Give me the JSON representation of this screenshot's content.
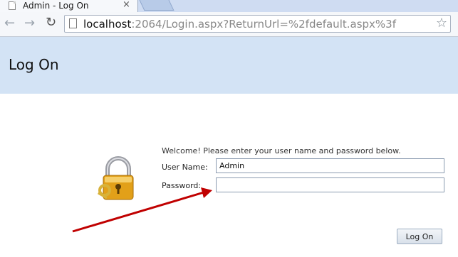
{
  "browser": {
    "tab_title": "Admin - Log On",
    "tab_close": "×",
    "url_host": "localhost",
    "url_rest": ":2064/Login.aspx?ReturnUrl=%2fdefault.aspx%3f",
    "back_glyph": "←",
    "forward_glyph": "→",
    "reload_glyph": "↻",
    "star_glyph": "☆"
  },
  "page": {
    "title": "Log On",
    "welcome": "Welcome! Please enter your user name and password below.",
    "username_label": "User Name:",
    "username_value": "Admin",
    "password_label": "Password:",
    "password_value": "",
    "logon_button": "Log On"
  },
  "colors": {
    "header_bg": "#d3e3f5",
    "arrow": "#c00000"
  }
}
